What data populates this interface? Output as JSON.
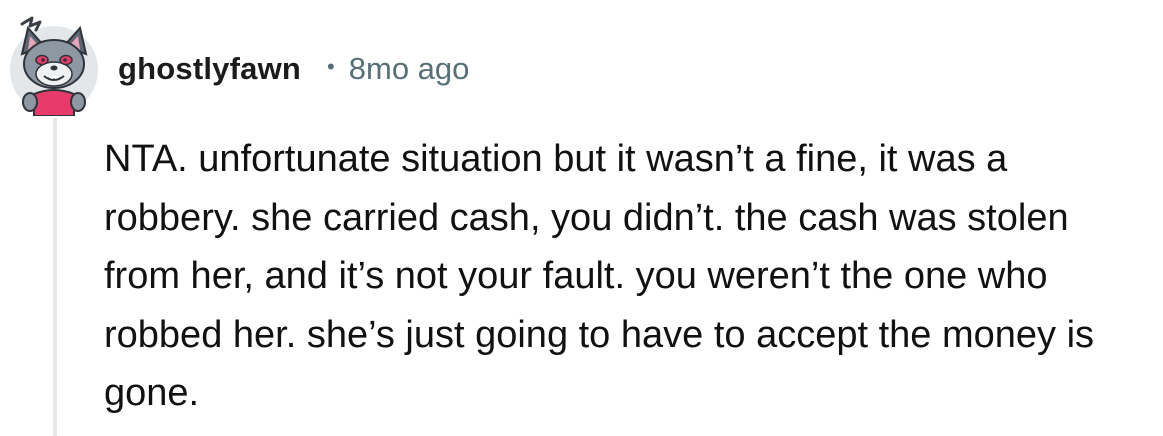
{
  "comment": {
    "author": "ghostlyfawn",
    "separator": "•",
    "timestamp": "8mo ago",
    "body": "NTA. unfortunate situation but it wasn’t a fine, it was a robbery. she carried cash, you didn’t. the cash was stolen from her, and it’s not your fault. you weren’t the one who robbed her. she’s just going to have to accept the money is gone."
  },
  "avatar": {
    "icon": "wolf-avatar-icon",
    "background_color": "#e4e7ea",
    "accent_color": "#e93b6b"
  },
  "colors": {
    "text": "#1a1a1b",
    "meta": "#576f76",
    "thread_line": "#e6e8ea"
  }
}
